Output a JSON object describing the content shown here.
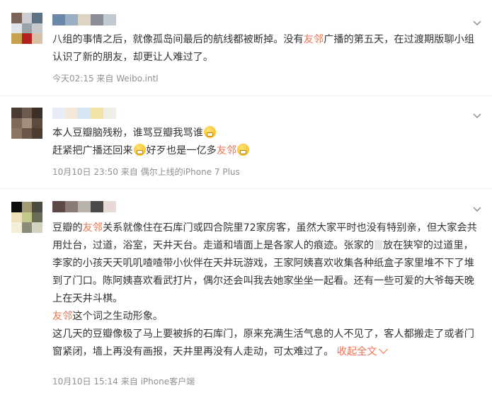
{
  "posts": [
    {
      "avatar_colors": [
        "#7c6358",
        "#c9ccd1",
        "#5b7286",
        "#dfe4e8",
        "#9aa2aa",
        "#c6c9cc",
        "#c9a24f",
        "#b22020",
        "#d7c1a6"
      ],
      "name_colors": [
        "#6a86a8",
        "#9aaec4",
        "#dfd4c3",
        "#8b8f95",
        "#c2c9d0"
      ],
      "text_parts": [
        "八组的事情之后，就像孤岛间最后的航线都被断掉。没有",
        "友邻",
        "广播的第五天，在过渡期版聊小组认识了新的朋友，却更让人难过了。"
      ],
      "meta": "今天02:15  来自 Weibo.intl"
    },
    {
      "avatar_colors": [
        "#4a3b33",
        "#6d5a4d",
        "#3a2f29",
        "#7e6a58",
        "#a48d7a",
        "#5c4a3e",
        "#8b7562",
        "#6a5547",
        "#4c3d33"
      ],
      "name_colors": [
        "#e8ecf4",
        "#f4e9d9",
        "#d6e6f2",
        "#f3e2a6",
        "#eef0e8"
      ],
      "line1": "本人豆瓣脑残粉，谁骂豆瓣我骂谁",
      "line2_a": "赶紧把广播还回来",
      "line2_b": "好歹也是一亿多",
      "line2_mention": "友邻",
      "meta": "10月10日 23:50  来自 偶尔上线的iPhone 7 Plus"
    },
    {
      "avatar_colors": [
        "#0e0e0e",
        "#a19a72",
        "#4b4d42",
        "#ece1b8",
        "#c2c98a",
        "#6b6d5b",
        "#f2eed8",
        "#8c8c7a",
        "#d3d1bf"
      ],
      "name_colors": [
        "#5b4a46",
        "#8a7a74",
        "#b7b2ab",
        "#4a4a4a",
        "#e8d9d6"
      ],
      "para1_a": "豆瓣的",
      "para1_mention": "友邻",
      "para1_b": "关系就像住在石库门或四合院里72家房客，虽然大家平时也没有特别亲，但大家会共用灶台，过道，浴室，天井天台。走道和墙面上是各家人的痕迹。张家的",
      "para1_c": "放在狭窄的过道里，李家的小孩天天叽叽喳喳带小伙伴在天井玩游戏，王家阿姨喜欢收集各种纸盒子家里堆不下了堆到了门口。陈阿姨喜欢看武打片，偶尔还会叫我去她家坐坐一起看。还有一些可爱的大爷每天晚上在天井斗棋。",
      "para2_mention": "友邻",
      "para2_b": "这个词之生动形象。",
      "para3": "这几天的豆瓣像极了马上要被拆的石库门，原来充满生活气息的人不见了，客人都搬走了或者门窗紧闭，墙上再没有画报，天井里再没有人走动，可太难过了。",
      "collapse": "收起全文",
      "meta": "10月10日 15:14  来自 iPhone客户端"
    }
  ],
  "colors": {
    "accent": "#eb7350",
    "meta": "#909090",
    "text": "#333333"
  }
}
